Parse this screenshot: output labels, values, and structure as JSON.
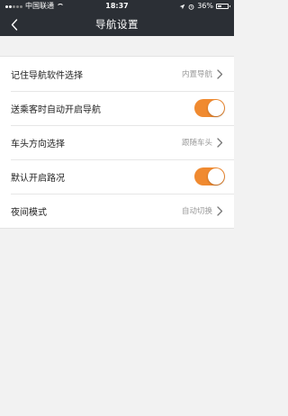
{
  "status_bar": {
    "carrier": "中国联通",
    "time": "18:37",
    "battery": "36%",
    "battery_level": 0.36
  },
  "nav": {
    "title": "导航设置",
    "back_icon": "chevron-left-icon"
  },
  "colors": {
    "header": "#2b2f35",
    "accent": "#f08a30",
    "background": "#f2f2f2"
  },
  "settings": {
    "items": [
      {
        "label": "记住导航软件选择",
        "value": "内置导航",
        "type": "select"
      },
      {
        "label": "送乘客时自动开启导航",
        "type": "toggle",
        "on": true
      },
      {
        "label": "车头方向选择",
        "value": "跟随车头",
        "type": "select"
      },
      {
        "label": "默认开启路况",
        "type": "toggle",
        "on": true
      },
      {
        "label": "夜间模式",
        "value": "自动切换",
        "type": "select"
      }
    ]
  }
}
